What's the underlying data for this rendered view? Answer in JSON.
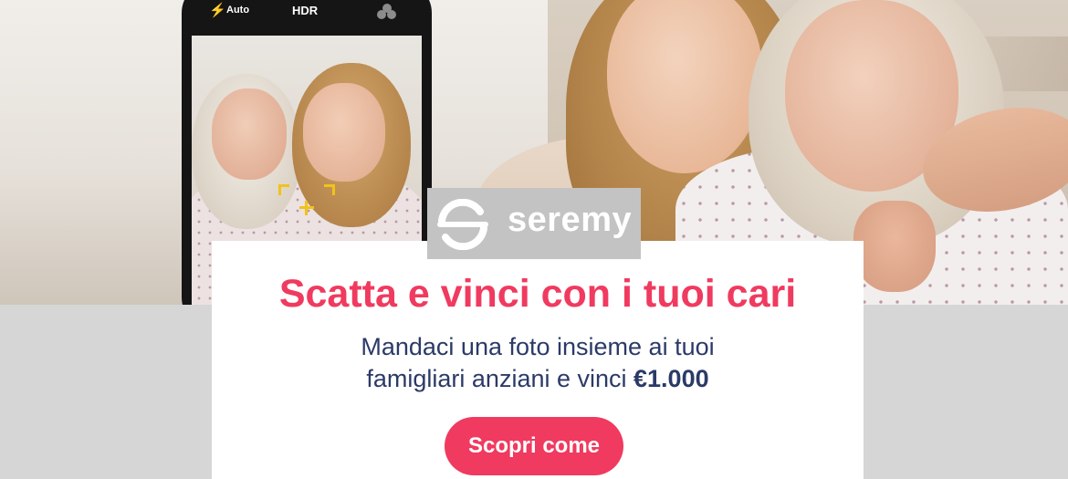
{
  "phone": {
    "flash_icon": "⚡",
    "flash_mode": "Auto",
    "hdr": "HDR"
  },
  "brand": {
    "name": "seremy"
  },
  "banner": {
    "headline": "Scatta e vinci con i tuoi cari",
    "subline_1": "Mandaci una foto insieme ai tuoi",
    "subline_2_prefix": "famigliari anziani e vinci ",
    "prize": "€1.000"
  },
  "cta": {
    "label": "Scopri come"
  },
  "colors": {
    "accent": "#f03a5f",
    "text_dark": "#2b3a67",
    "band": "#d6d6d6",
    "logo_bg": "#c3c3c3",
    "focus": "#f1c21b"
  }
}
